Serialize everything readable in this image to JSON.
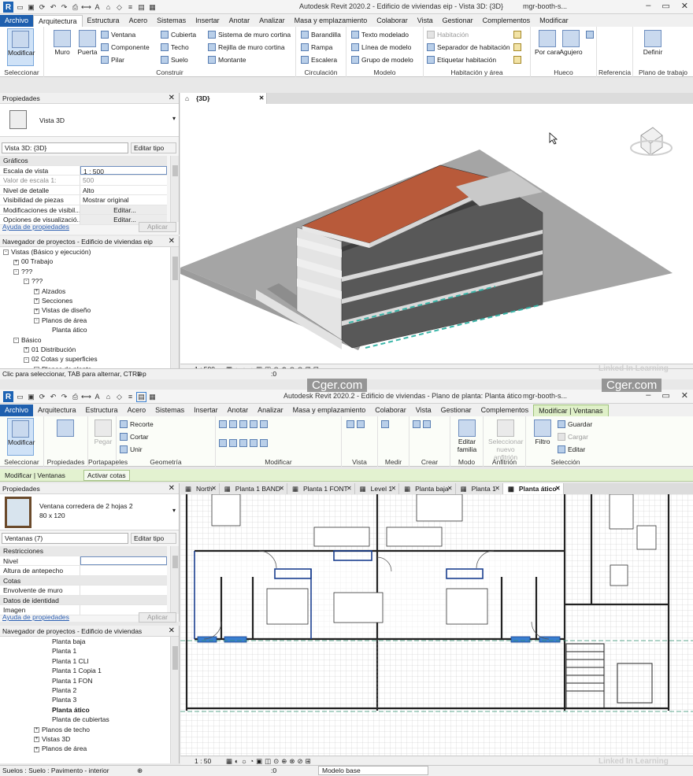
{
  "top": {
    "title": "Autodesk Revit 2020.2 - Edificio de viviendas eip - Vista 3D: {3D}",
    "user": "mgr-booth-s...",
    "tabs": [
      "Archivo",
      "Arquitectura",
      "Estructura",
      "Acero",
      "Sistemas",
      "Insertar",
      "Anotar",
      "Analizar",
      "Masa y emplazamiento",
      "Colaborar",
      "Vista",
      "Gestionar",
      "Complementos",
      "Modificar"
    ],
    "ribbon": {
      "modificar": "Modificar",
      "seleccionar": "Seleccionar",
      "muro": "Muro",
      "puerta": "Puerta",
      "ventana": "Ventana",
      "componente": "Componente",
      "pilar": "Pilar",
      "cubierta": "Cubierta",
      "techo": "Techo",
      "suelo": "Suelo",
      "sistema_muro": "Sistema de muro cortina",
      "rejilla": "Rejilla de muro cortina",
      "montante": "Montante",
      "construir": "Construir",
      "barandilla": "Barandilla",
      "rampa": "Rampa",
      "escalera": "Escalera",
      "circulacion": "Circulación",
      "texto_modelado": "Texto modelado",
      "linea_modelo": "Línea de modelo",
      "grupo_modelo": "Grupo de modelo",
      "modelo": "Modelo",
      "habitacion": "Habitación",
      "separador": "Separador de habitación",
      "etiquetar": "Etiquetar habitación",
      "hab_area": "Habitación y área",
      "por_cara": "Por cara",
      "agujero": "Agujero",
      "hueco": "Hueco",
      "referencia": "Referencia",
      "definir": "Definir",
      "plano_trabajo": "Plano de trabajo"
    },
    "props": {
      "title": "Propiedades",
      "type": "Vista 3D",
      "selector": "Vista 3D: {3D}",
      "edit_type": "Editar tipo",
      "rows": [
        {
          "k": "Gráficos",
          "v": "",
          "grp": true
        },
        {
          "k": "Escala de vista",
          "v": "1 : 500"
        },
        {
          "k": "Valor de escala    1:",
          "v": "500"
        },
        {
          "k": "Nivel de detalle",
          "v": "Alto"
        },
        {
          "k": "Visibilidad de piezas",
          "v": "Mostrar original"
        },
        {
          "k": "Modificaciones de visibil...",
          "v": "Editar..."
        },
        {
          "k": "Opciones de visualizació...",
          "v": "Editar..."
        }
      ],
      "help": "Ayuda de propiedades",
      "apply": "Aplicar"
    },
    "browser": {
      "title": "Navegador de proyectos - Edificio de viviendas eip",
      "items": [
        {
          "t": "Vistas (Básico y ejecución)",
          "l": 0,
          "pm": "-"
        },
        {
          "t": "00 Trabajo",
          "l": 1,
          "pm": "+"
        },
        {
          "t": "???",
          "l": 1,
          "pm": "-"
        },
        {
          "t": "???",
          "l": 2,
          "pm": "-"
        },
        {
          "t": "Alzados",
          "l": 3,
          "pm": "+"
        },
        {
          "t": "Secciones",
          "l": 3,
          "pm": "+"
        },
        {
          "t": "Vistas de diseño",
          "l": 3,
          "pm": "+"
        },
        {
          "t": "Planos de área",
          "l": 3,
          "pm": "-"
        },
        {
          "t": "Planta ático",
          "l": 4,
          "pm": ""
        },
        {
          "t": "Básico",
          "l": 1,
          "pm": "-"
        },
        {
          "t": "01 Distribución",
          "l": 2,
          "pm": "+"
        },
        {
          "t": "02 Cotas y superficies",
          "l": 2,
          "pm": "-"
        },
        {
          "t": "Planos de planta",
          "l": 3,
          "pm": "-"
        }
      ]
    },
    "viewtab": "{3D}",
    "scale": "1 : 500",
    "status": "Clic para seleccionar, TAB para alternar, CTRL p",
    "status_zero": ":0"
  },
  "bottom": {
    "title": "Autodesk Revit 2020.2 - Edificio de viviendas - Plano de planta: Planta ático",
    "user": "mgr-booth-s...",
    "tabs": [
      "Archivo",
      "Arquitectura",
      "Estructura",
      "Acero",
      "Sistemas",
      "Insertar",
      "Anotar",
      "Analizar",
      "Masa y emplazamiento",
      "Colaborar",
      "Vista",
      "Gestionar",
      "Complementos",
      "Modificar | Ventanas"
    ],
    "ribbon": {
      "modificar": "Modificar",
      "seleccionar": "Seleccionar",
      "propiedades": "Propiedades",
      "portapapeles": "Portapapeles",
      "pegar": "Pegar",
      "recorte": "Recorte",
      "cortar": "Cortar",
      "unir": "Unir",
      "geometria": "Geometría",
      "modificar_p": "Modificar",
      "vista": "Vista",
      "medir": "Medir",
      "crear": "Crear",
      "editar_familia": "Editar familia",
      "modo": "Modo",
      "seleccionar_anfitrion": "Seleccionar nuevo anfitrión",
      "anfitrion": "Anfitrión",
      "filtro": "Filtro",
      "guardar": "Guardar",
      "cargar": "Cargar",
      "editar": "Editar",
      "seleccion": "Selección"
    },
    "ctx": {
      "label": "Modificar | Ventanas",
      "button": "Activar cotas"
    },
    "props": {
      "title": "Propiedades",
      "type": "Ventana corredera de 2 hojas 2",
      "type2": "80 x 120",
      "selector": "Ventanas (7)",
      "edit_type": "Editar tipo",
      "rows": [
        {
          "k": "Restricciones",
          "v": "",
          "grp": true
        },
        {
          "k": "Nivel",
          "v": ""
        },
        {
          "k": "Altura de antepecho",
          "v": ""
        },
        {
          "k": "Cotas",
          "v": "",
          "grp": true
        },
        {
          "k": "Envolvente de muro",
          "v": ""
        },
        {
          "k": "Datos de identidad",
          "v": "",
          "grp": true
        },
        {
          "k": "Imagen",
          "v": ""
        }
      ],
      "help": "Ayuda de propiedades",
      "apply": "Aplicar"
    },
    "browser": {
      "title": "Navegador de proyectos - Edificio de viviendas",
      "items": [
        {
          "t": "Planta baja",
          "l": 4,
          "pm": ""
        },
        {
          "t": "Planta 1",
          "l": 4,
          "pm": ""
        },
        {
          "t": "Planta 1 CLI",
          "l": 4,
          "pm": ""
        },
        {
          "t": "Planta 1 Copia 1",
          "l": 4,
          "pm": ""
        },
        {
          "t": "Planta 1 FON",
          "l": 4,
          "pm": ""
        },
        {
          "t": "Planta 2",
          "l": 4,
          "pm": ""
        },
        {
          "t": "Planta 3",
          "l": 4,
          "pm": ""
        },
        {
          "t": "Planta ático",
          "l": 4,
          "pm": "",
          "b": true
        },
        {
          "t": "Planta de cubiertas",
          "l": 4,
          "pm": ""
        },
        {
          "t": "Planos de techo",
          "l": 3,
          "pm": "+"
        },
        {
          "t": "Vistas 3D",
          "l": 3,
          "pm": "+"
        },
        {
          "t": "Planos de área",
          "l": 3,
          "pm": "+"
        }
      ]
    },
    "viewtabs": [
      "North",
      "Planta 1 BAND",
      "Planta 1 FONT",
      "Level 1",
      "Planta baja",
      "Planta 1",
      "Planta ático"
    ],
    "scale": "1 : 50",
    "status": "Suelos : Suelo : Pavimento - interior",
    "status_zero": ":0",
    "status_model": "Modelo base"
  },
  "watermark": "Cger.com",
  "linkedin": "Linked In Learning"
}
